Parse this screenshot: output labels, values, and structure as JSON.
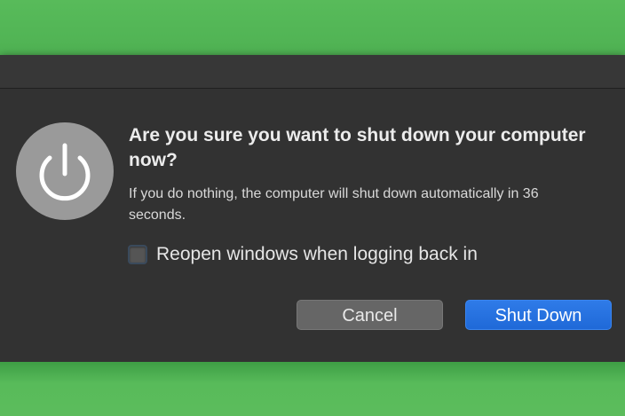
{
  "dialog": {
    "title": "Are you sure you want to shut down your computer now?",
    "message": "If you do nothing, the computer will shut down automatically in 36 seconds.",
    "icon": "power-icon",
    "checkbox": {
      "label": "Reopen windows when logging back in",
      "checked": false
    },
    "buttons": {
      "cancel_label": "Cancel",
      "confirm_label": "Shut Down"
    }
  },
  "colors": {
    "backdrop": "#5cb85c",
    "dialog_background": "#323232",
    "primary_button": "#2a74e2",
    "secondary_button": "#666666",
    "icon_circle": "#9a9a9a"
  }
}
